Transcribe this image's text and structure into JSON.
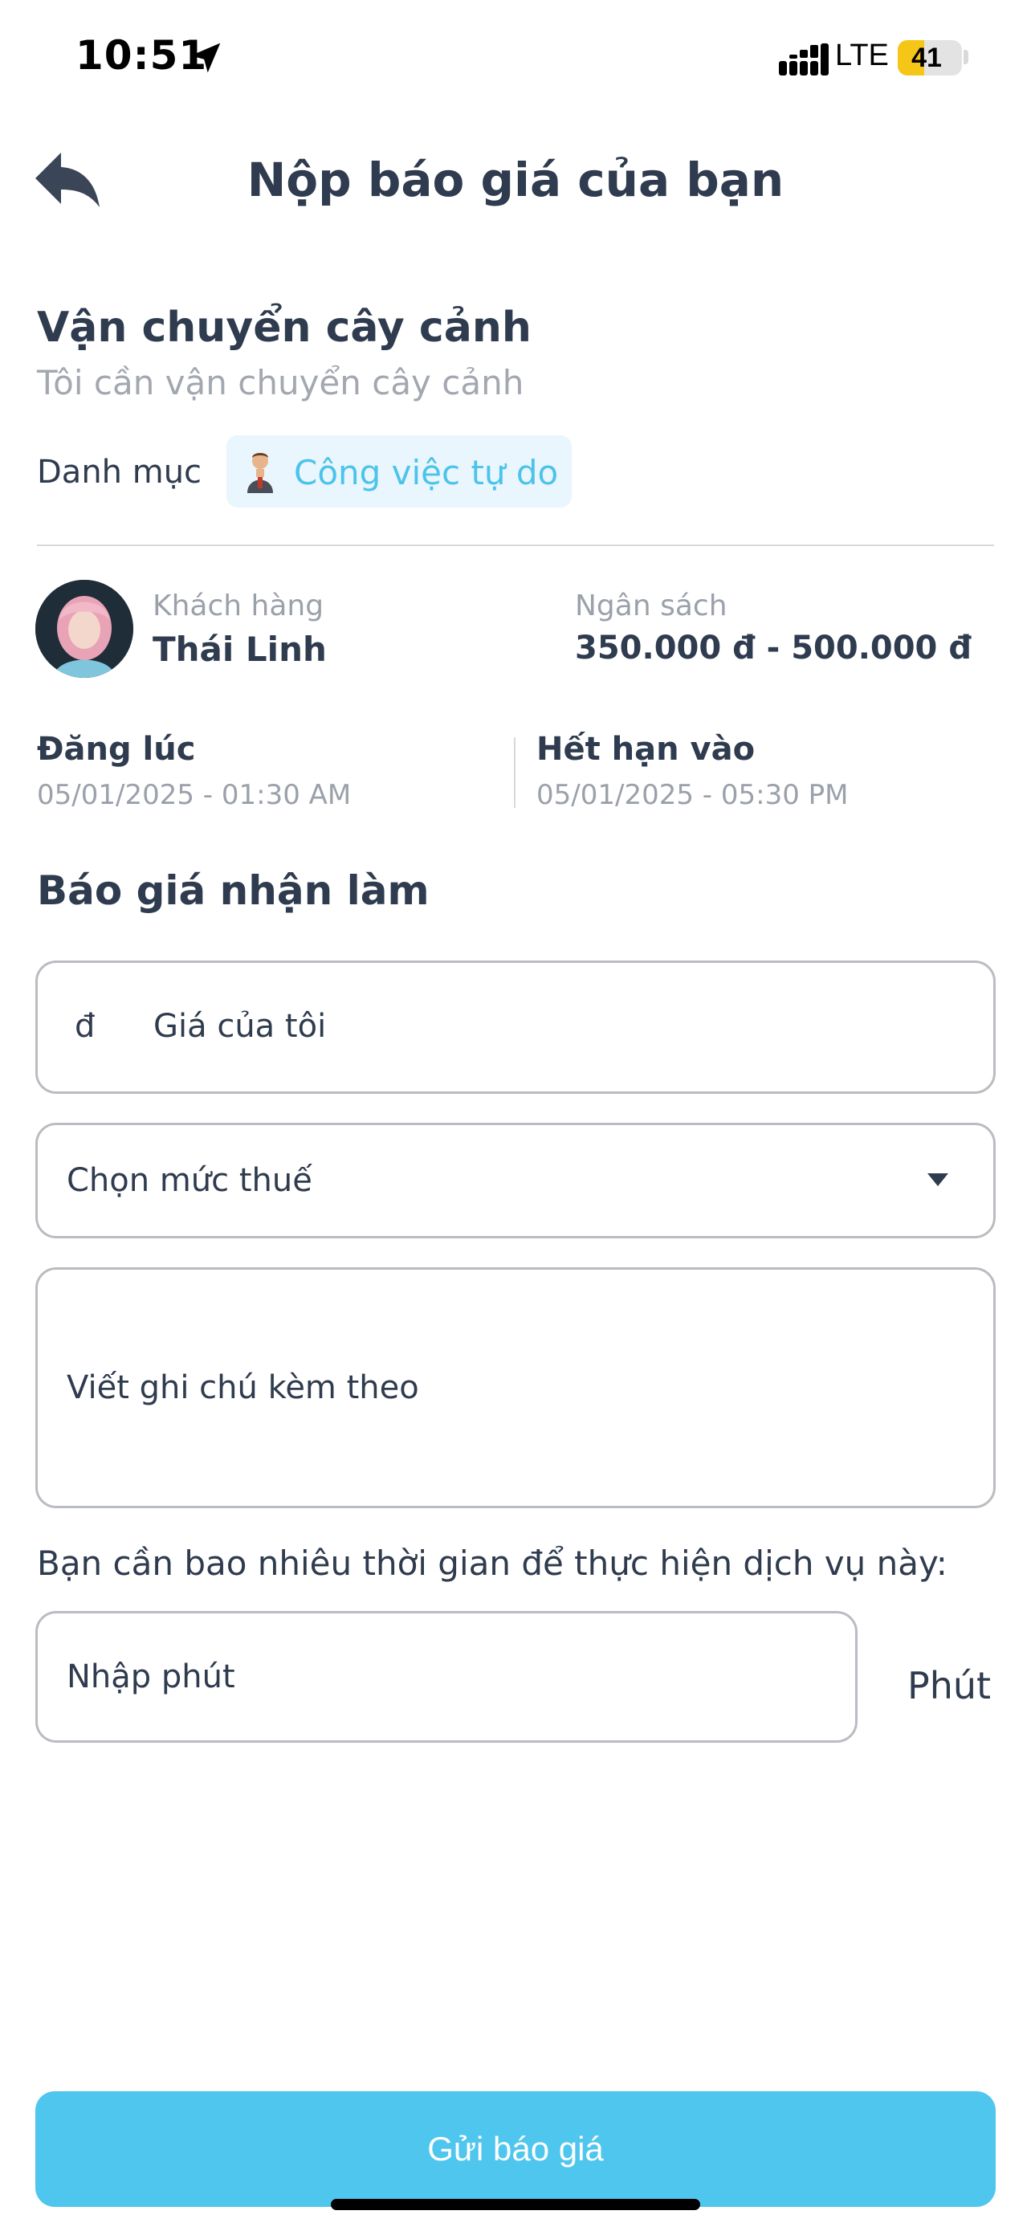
{
  "status_bar": {
    "time": "10:51",
    "network": "LTE",
    "battery": "41",
    "battery_level": 0.41,
    "location_icon": "location-arrow-icon",
    "signal_icon": "signal-bars-icon"
  },
  "header": {
    "title": "Nộp báo giá của bạn",
    "back_icon": "reply-arrow-icon"
  },
  "job": {
    "title": "Vận chuyển cây cảnh",
    "description": "Tôi cần vận chuyển cây cảnh",
    "category_label": "Danh mục",
    "category_value": "Công việc tự do",
    "category_icon": "person-avatar-icon"
  },
  "client": {
    "label": "Khách hàng",
    "name": "Thái Linh",
    "budget_label": "Ngân sách",
    "budget_value": "350.000 đ - 500.000 đ"
  },
  "dates": {
    "posted_label": "Đăng lúc",
    "posted_value": "05/01/2025 - 01:30 AM",
    "expire_label": "Hết hạn vào",
    "expire_value": "05/01/2025 - 05:30 PM"
  },
  "quote_form": {
    "section_title": "Báo giá nhận làm",
    "price_prefix": "đ",
    "price_placeholder": "Giá của tôi",
    "tax_placeholder": "Chọn mức thuế",
    "note_placeholder": "Viết ghi chú kèm theo",
    "time_question": "Bạn cần bao nhiêu thời gian để thực hiện dịch vụ này:",
    "minutes_placeholder": "Nhập phút",
    "minutes_unit": "Phút",
    "submit_label": "Gửi báo giá"
  },
  "colors": {
    "accent": "#4fc6ee",
    "chip_bg": "#e9f6fd",
    "chip_text": "#4cc3ea",
    "text_primary": "#2f3b4e",
    "text_muted": "#9ba1aa",
    "battery_fill": "#f5c518"
  }
}
